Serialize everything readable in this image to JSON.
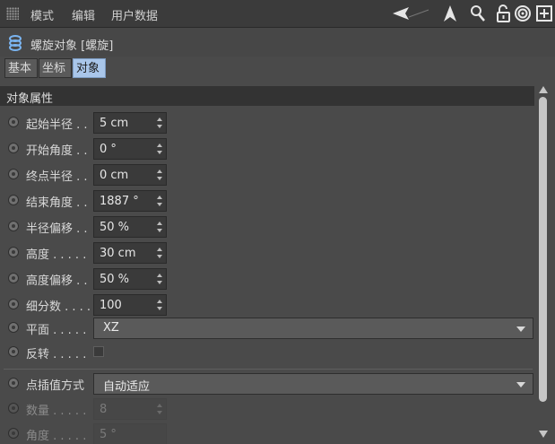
{
  "menu": {
    "mode": "模式",
    "edit": "编辑",
    "userdata": "用户数据"
  },
  "object": {
    "title": "螺旋对象 [螺旋]"
  },
  "tabs": [
    {
      "label": "基本",
      "active": false
    },
    {
      "label": "坐标",
      "active": false
    },
    {
      "label": "对象",
      "active": true
    }
  ],
  "section": {
    "title": "对象属性"
  },
  "fields": [
    {
      "label": "起始半径 . .",
      "value": "5 cm"
    },
    {
      "label": "开始角度 . .",
      "value": "0 °"
    },
    {
      "label": "终点半径 . .",
      "value": "0 cm"
    },
    {
      "label": "结束角度 . .",
      "value": "1887 °"
    },
    {
      "label": "半径偏移 . .",
      "value": "50 %"
    },
    {
      "label": "高度 . . . . .",
      "value": "30 cm"
    },
    {
      "label": "高度偏移 . .",
      "value": "50 %"
    },
    {
      "label": "细分数 . . . .",
      "value": "100"
    }
  ],
  "plane": {
    "label": "平面 . . . . .",
    "value": "XZ"
  },
  "reverse": {
    "label": "反转 . . . . .",
    "checked": false
  },
  "interpolation": {
    "label": "点插值方式",
    "value": "自动适应"
  },
  "count": {
    "label": "数量 . . . . .",
    "value": "8"
  },
  "angle": {
    "label": "角度 . . . . .",
    "value": "5 °"
  },
  "colors": {
    "accent_tab": "#a9c6ea",
    "background": "#4a4a4a"
  }
}
